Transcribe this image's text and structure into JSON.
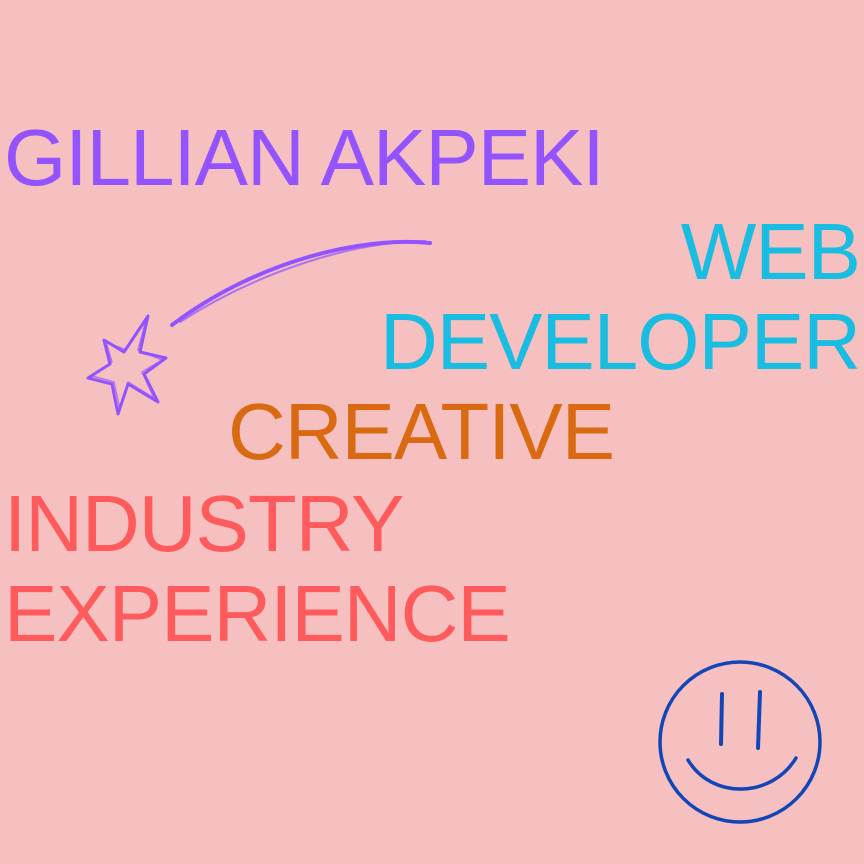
{
  "name": "GILLIAN AKPEKI",
  "role_line1": "WEB",
  "role_line2": "DEVELOPER",
  "tag_line1": "CREATIVE",
  "tag_line2": "INDUSTRY",
  "tag_line3": "EXPERIENCE",
  "colors": {
    "background": "#f5c0bf",
    "name": "#9353ff",
    "role": "#19bde2",
    "creative": "#d96a12",
    "experience": "#ff5a5c",
    "smiley": "#1245b8",
    "star": "#9353ff"
  },
  "icons": {
    "shooting_star": "shooting-star-icon",
    "smiley_face": "smiley-face-icon"
  }
}
